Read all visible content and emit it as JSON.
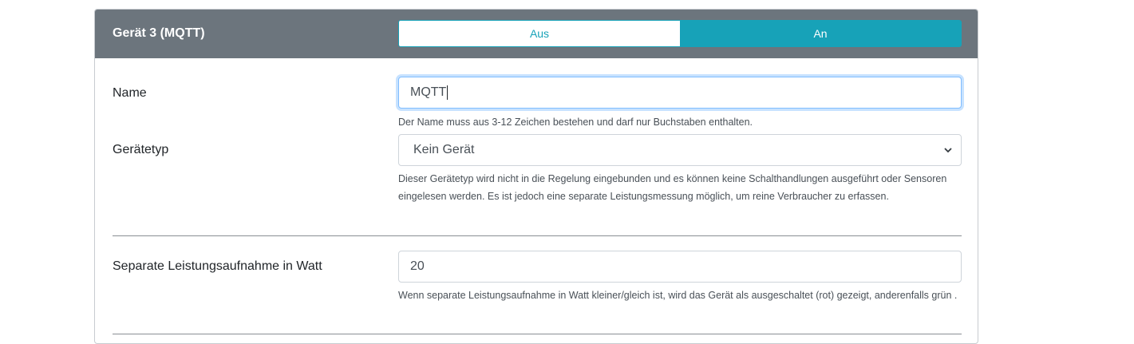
{
  "device_card": {
    "title": "Gerät 3 (MQTT)",
    "toggle": {
      "off_label": "Aus",
      "on_label": "An",
      "selected": "An"
    }
  },
  "fields": {
    "name": {
      "label": "Name",
      "value": "MQTT",
      "help": "Der Name muss aus 3-12 Zeichen bestehen und darf nur Buchstaben enthalten."
    },
    "device_type": {
      "label": "Gerätetyp",
      "selected": "Kein Gerät",
      "help": "Dieser Gerätetyp wird nicht in die Regelung eingebunden und es können keine Schalthandlungen ausgeführt oder Sensoren eingelesen werden. Es ist jedoch eine separate Leistungsmessung möglich, um reine Verbraucher zu erfassen."
    },
    "power": {
      "label": "Separate Leistungsaufnahme in Watt",
      "value": "20",
      "help": "Wenn separate Leistungsaufnahme in Watt kleiner/gleich ist, wird das Gerät als ausgeschaltet (rot) gezeigt, anderenfalls grün ."
    }
  },
  "icons": {
    "select_chevron": "chevron-down-icon"
  },
  "colors": {
    "header_bg": "#6c757d",
    "accent": "#17a2b8"
  }
}
